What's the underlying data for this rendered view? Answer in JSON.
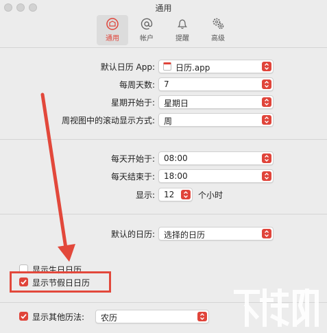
{
  "window": {
    "title": "通用"
  },
  "toolbar": {
    "items": [
      {
        "label": "通用",
        "icon": "general-icon",
        "active": true
      },
      {
        "label": "帐户",
        "icon": "at-icon",
        "active": false
      },
      {
        "label": "提醒",
        "icon": "bell-icon",
        "active": false
      },
      {
        "label": "高级",
        "icon": "gears-icon",
        "active": false
      }
    ]
  },
  "section1": {
    "default_app": {
      "label": "默认日历 App:",
      "value": "日历.app"
    },
    "days_per_week": {
      "label": "每周天数:",
      "value": "7"
    },
    "week_starts": {
      "label": "星期开始于:",
      "value": "星期日"
    },
    "week_scroll": {
      "label": "周视图中的滚动显示方式:",
      "value": "周"
    }
  },
  "section2": {
    "day_start": {
      "label": "每天开始于:",
      "value": "08:00"
    },
    "day_end": {
      "label": "每天结束于:",
      "value": "18:00"
    },
    "show": {
      "label": "显示:",
      "value": "12",
      "unit": "个小时"
    }
  },
  "section3": {
    "default_calendar": {
      "label": "默认的日历:",
      "value": "选择的日历"
    }
  },
  "options": {
    "birthdays": {
      "label": "显示生日日历",
      "checked": false
    },
    "holidays": {
      "label": "显示节假日日历",
      "checked": true
    },
    "other_calendars": {
      "label": "显示其他历法:",
      "checked": true,
      "value": "农历"
    }
  },
  "colors": {
    "accent": "#e0443a",
    "annotation": "#e2483b"
  }
}
